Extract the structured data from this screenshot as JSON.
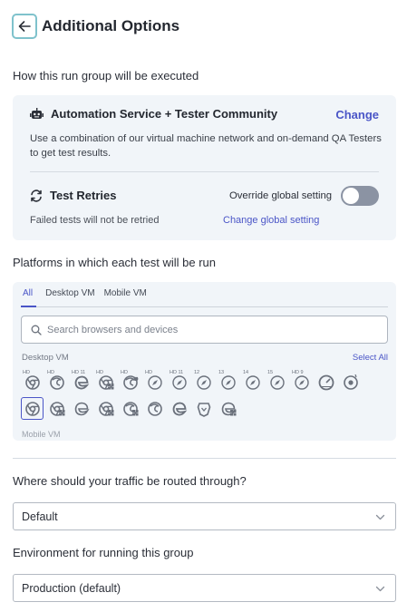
{
  "header": {
    "title": "Additional Options"
  },
  "execution": {
    "section_label": "How this run group will be executed",
    "service_title": "Automation Service + Tester Community",
    "change_label": "Change",
    "description": "Use a combination of our virtual machine network and on-demand QA Testers to get test results.",
    "retries_title": "Test Retries",
    "override_label": "Override global setting",
    "override_enabled": false,
    "retry_note": "Failed tests will not be retried",
    "global_link": "Change global setting"
  },
  "platforms": {
    "section_label": "Platforms in which each test will be run",
    "tabs": [
      {
        "label": "All",
        "active": true
      },
      {
        "label": "Desktop VM",
        "active": false
      },
      {
        "label": "Mobile VM",
        "active": false
      }
    ],
    "search_placeholder": "Search browsers and devices",
    "desktop_label": "Desktop VM",
    "select_all_label": "Select All",
    "mobile_label_peek": "Mobile VM",
    "row1": [
      {
        "icon": "chrome-icon",
        "ver": "HD"
      },
      {
        "icon": "firefox-icon",
        "ver": "HD"
      },
      {
        "icon": "edge-legacy-icon",
        "ver": "HD 11"
      },
      {
        "icon": "chrome-win-icon",
        "ver": "HD"
      },
      {
        "icon": "firefox-mac-icon",
        "ver": "HD"
      },
      {
        "icon": "safari-icon",
        "ver": "HD"
      },
      {
        "icon": "safari-icon",
        "ver": "HD 11"
      },
      {
        "icon": "safari-icon",
        "ver": "12"
      },
      {
        "icon": "safari-icon",
        "ver": "13"
      },
      {
        "icon": "safari-icon",
        "ver": "14"
      },
      {
        "icon": "safari-icon",
        "ver": "15"
      },
      {
        "icon": "safari-icon",
        "ver": "HD 9"
      },
      {
        "icon": "gauge-icon",
        "ver": ""
      },
      {
        "icon": "chrome-dev-icon",
        "ver": ""
      }
    ],
    "row2": [
      {
        "icon": "chrome-icon",
        "selected": true
      },
      {
        "icon": "chrome-win-icon",
        "selected": false
      },
      {
        "icon": "edge-icon",
        "selected": false
      },
      {
        "icon": "chrome-win-icon",
        "selected": false
      },
      {
        "icon": "firefox-win-icon",
        "selected": false
      },
      {
        "icon": "firefox-icon",
        "selected": false
      },
      {
        "icon": "edge-legacy-icon",
        "selected": false
      },
      {
        "icon": "brave-icon",
        "selected": false
      },
      {
        "icon": "edge-win-icon",
        "selected": false
      }
    ]
  },
  "routing": {
    "section_label": "Where should your traffic be routed through?",
    "value": "Default"
  },
  "environment": {
    "section_label": "Environment for running this group",
    "value": "Production (default)"
  },
  "colors": {
    "accent": "#4a55c7",
    "card_bg": "#f1f5f9",
    "back_border": "#7fc2cc"
  }
}
